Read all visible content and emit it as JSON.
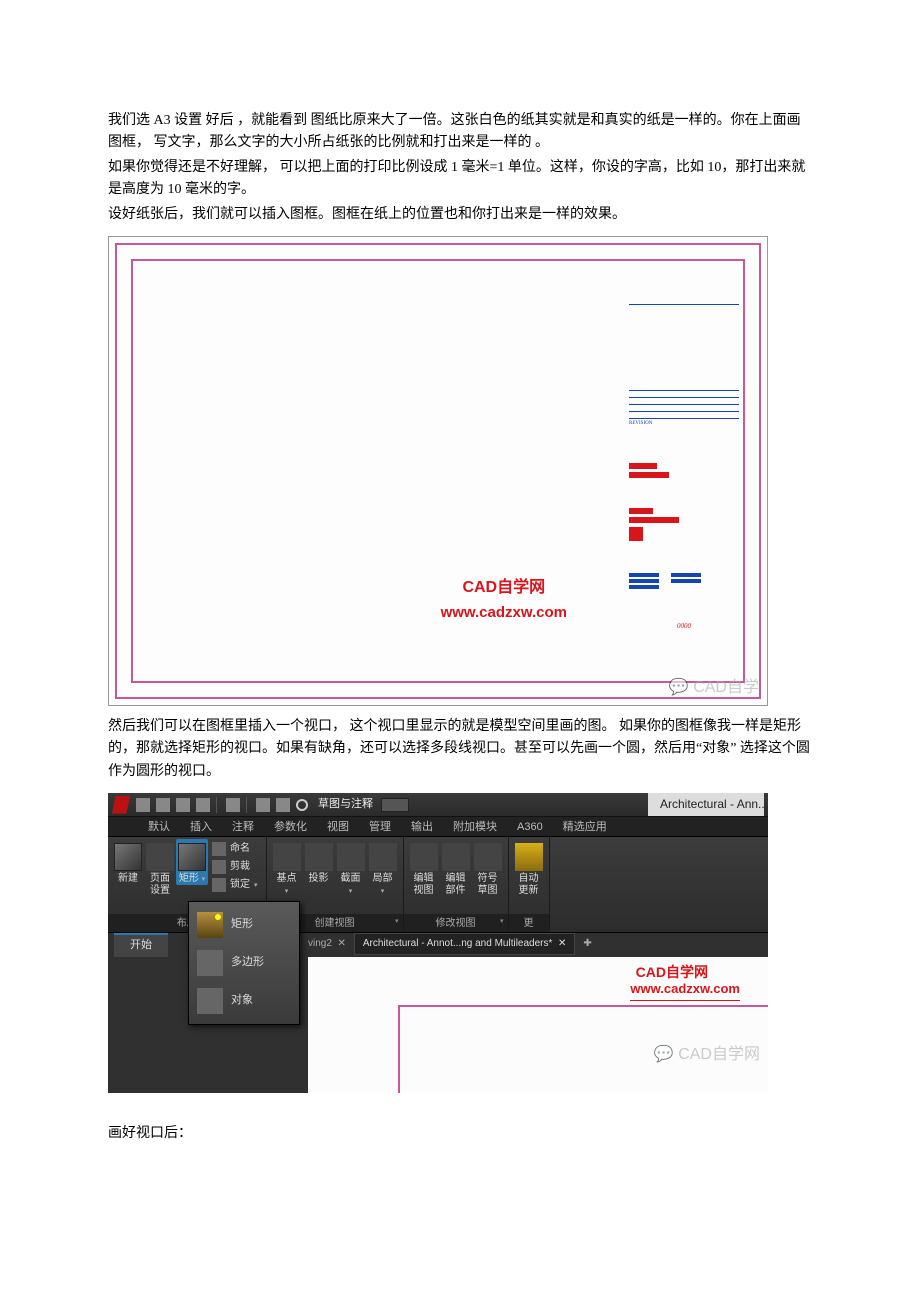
{
  "paragraphs": {
    "p1": "我们选 A3 设置 好后 ，就能看到 图纸比原来大了一倍。这张白色的纸其实就是和真实的纸是一样的。你在上面画图框， 写文字，那么文字的大小所占纸张的比例就和打出来是一样的 。",
    "p2": "如果你觉得还是不好理解， 可以把上面的打印比例设成 1 毫米=1 单位。这样，你设的字高，比如 10，那打出来就是高度为 10 毫米的字。",
    "p3": "设好纸张后，我们就可以插入图框。图框在纸上的位置也和你打出来是一样的效果。",
    "p4": "然后我们可以在图框里插入一个视口， 这个视口里显示的就是模型空间里画的图。 如果你的图框像我一样是矩形的，那就选择矩形的视口。如果有缺角，还可以选择多段线视口。甚至可以先画一个圆，然后用“对象” 选择这个圆作为圆形的视口。",
    "p5": "画好视口后："
  },
  "image1": {
    "logo": "CAD自学网",
    "url": "www.cadzxw.com",
    "watermark": "CAD自学",
    "revision_label": "REVISION"
  },
  "image2": {
    "qat_label": "草图与注释",
    "workspace": "Architectural - Ann...",
    "tabs": [
      "默认",
      "插入",
      "注释",
      "参数化",
      "视图",
      "管理",
      "输出",
      "附加模块",
      "A360",
      "精选应用"
    ],
    "ribbon": {
      "btn_new": "新建",
      "btn_page": "页面\n设置",
      "btn_rect": "矩形",
      "small_name": "命名",
      "small_clip": "剪裁",
      "small_lock": "锁定",
      "group_layout": "布局",
      "btn_base": "基点",
      "btn_proj": "投影",
      "btn_sect": "截面",
      "btn_local": "局部",
      "group_create": "创建视图",
      "btn_editv": "编辑\n视图",
      "btn_editp": "编辑\n部件",
      "btn_sym": "符号\n草图",
      "group_modify": "修改视图",
      "btn_auto": "自动\n更新",
      "group_update": "更"
    },
    "menu": {
      "rect": "矩形",
      "poly": "多边形",
      "obj": "对象"
    },
    "home_tab": "开始",
    "file_tab1_suffix": "ving2",
    "file_tab2": "Architectural - Annot...ng and Multileaders*",
    "logo": "CAD自学网",
    "url": "www.cadzxw.com",
    "watermark": "CAD自学网"
  }
}
